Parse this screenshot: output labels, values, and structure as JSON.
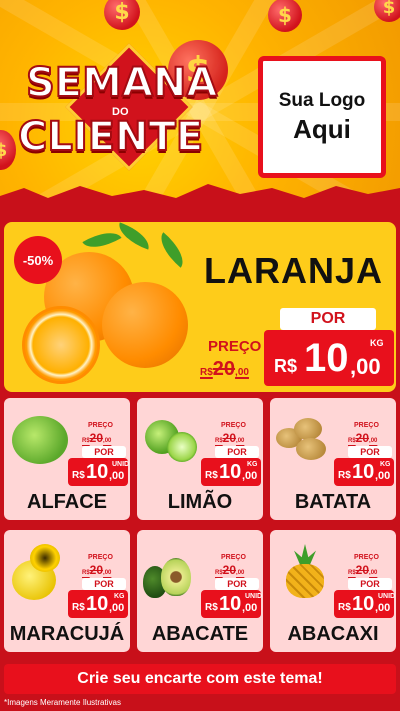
{
  "header": {
    "title_line1": "SEMANA",
    "title_do": "DO",
    "title_line2": "CLIENTE",
    "logo_line1": "Sua Logo",
    "logo_line2": "Aqui",
    "coin_symbol": "$"
  },
  "featured": {
    "name": "LARANJA",
    "discount": "-50%",
    "preco_label": "PREÇO",
    "old_currency": "R$",
    "old_price_int": "20",
    "old_price_dec": ",00",
    "por_label": "POR",
    "currency": "R$",
    "price_int": "10",
    "price_dec": ",00",
    "unit": "KG"
  },
  "products": [
    {
      "name": "ALFACE",
      "preco_label": "PREÇO",
      "old_currency": "R$",
      "old_int": "20",
      "old_dec": ",00",
      "por_label": "POR",
      "currency": "R$",
      "int": "10",
      "dec": ",00",
      "unit": "UNID"
    },
    {
      "name": "LIMÃO",
      "preco_label": "PREÇO",
      "old_currency": "R$",
      "old_int": "20",
      "old_dec": ",00",
      "por_label": "POR",
      "currency": "R$",
      "int": "10",
      "dec": ",00",
      "unit": "KG"
    },
    {
      "name": "BATATA",
      "preco_label": "PREÇO",
      "old_currency": "R$",
      "old_int": "20",
      "old_dec": ",00",
      "por_label": "POR",
      "currency": "R$",
      "int": "10",
      "dec": ",00",
      "unit": "KG"
    },
    {
      "name": "MARACUJÁ",
      "preco_label": "PREÇO",
      "old_currency": "R$",
      "old_int": "20",
      "old_dec": ",00",
      "por_label": "POR",
      "currency": "R$",
      "int": "10",
      "dec": ",00",
      "unit": "KG"
    },
    {
      "name": "ABACATE",
      "preco_label": "PREÇO",
      "old_currency": "R$",
      "old_int": "20",
      "old_dec": ",00",
      "por_label": "POR",
      "currency": "R$",
      "int": "10",
      "dec": ",00",
      "unit": "UNID"
    },
    {
      "name": "ABACAXI",
      "preco_label": "PREÇO",
      "old_currency": "R$",
      "old_int": "20",
      "old_dec": ",00",
      "por_label": "POR",
      "currency": "R$",
      "int": "10",
      "dec": ",00",
      "unit": "UNID"
    }
  ],
  "banner": {
    "text": "Crie seu encarte com este tema!"
  },
  "footnote": "*Imagens Meramente Ilustrativas",
  "colors": {
    "primary_red": "#e8101c",
    "yellow": "#fecc1a",
    "card_pink": "#ffd6d6"
  }
}
